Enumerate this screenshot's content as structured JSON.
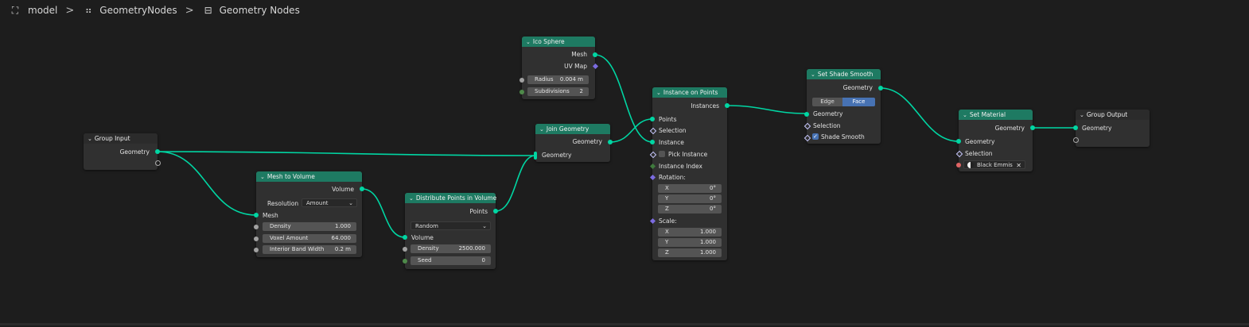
{
  "breadcrumb": {
    "items": [
      {
        "icon": "object-icon",
        "label": "model"
      },
      {
        "icon": "modifier-icon",
        "label": "GeometryNodes"
      },
      {
        "icon": "node-tree-icon",
        "label": "Geometry Nodes"
      }
    ],
    "separator": ">"
  },
  "colors": {
    "wire": "#00d6a3",
    "header": "#1e7a62",
    "node_bg": "#303030",
    "canvas": "#1d1d1d"
  },
  "chev": "⌄",
  "nodes": {
    "group_input": {
      "title": "Group Input",
      "out_geometry": "Geometry"
    },
    "mesh_to_volume": {
      "title": "Mesh to Volume",
      "out_volume": "Volume",
      "resolution_label": "Resolution",
      "resolution_value": "Amount",
      "in_mesh": "Mesh",
      "density_label": "Density",
      "density_value": "1.000",
      "voxel_label": "Voxel Amount",
      "voxel_value": "64.000",
      "band_label": "Interior Band Width",
      "band_value": "0.2 m"
    },
    "distribute": {
      "title": "Distribute Points in Volume",
      "out_points": "Points",
      "mode_value": "Random",
      "in_volume": "Volume",
      "density_label": "Density",
      "density_value": "2500.000",
      "seed_label": "Seed",
      "seed_value": "0"
    },
    "ico_sphere": {
      "title": "Ico Sphere",
      "out_mesh": "Mesh",
      "out_uvmap": "UV Map",
      "radius_label": "Radius",
      "radius_value": "0.004 m",
      "subdiv_label": "Subdivisions",
      "subdiv_value": "2"
    },
    "join_geometry": {
      "title": "Join Geometry",
      "out_geometry": "Geometry",
      "in_geometry": "Geometry"
    },
    "instance_on_points": {
      "title": "Instance on Points",
      "out_instances": "Instances",
      "in_points": "Points",
      "in_selection": "Selection",
      "in_instance": "Instance",
      "pick_instance": "Pick Instance",
      "instance_index": "Instance Index",
      "rotation": "Rotation:",
      "rot_x_label": "X",
      "rot_x_value": "0°",
      "rot_y_label": "Y",
      "rot_y_value": "0°",
      "rot_z_label": "Z",
      "rot_z_value": "0°",
      "scale": "Scale:",
      "sc_x_label": "X",
      "sc_x_value": "1.000",
      "sc_y_label": "Y",
      "sc_y_value": "1.000",
      "sc_z_label": "Z",
      "sc_z_value": "1.000"
    },
    "set_shade_smooth": {
      "title": "Set Shade Smooth",
      "out_geometry": "Geometry",
      "edge": "Edge",
      "face": "Face",
      "in_geometry": "Geometry",
      "in_selection": "Selection",
      "shade_smooth": "Shade Smooth",
      "shade_smooth_checked": true
    },
    "set_material": {
      "title": "Set Material",
      "out_geometry": "Geometry",
      "in_geometry": "Geometry",
      "in_selection": "Selection",
      "material": "Black Emmis"
    },
    "group_output": {
      "title": "Group Output",
      "in_geometry": "Geometry"
    }
  }
}
